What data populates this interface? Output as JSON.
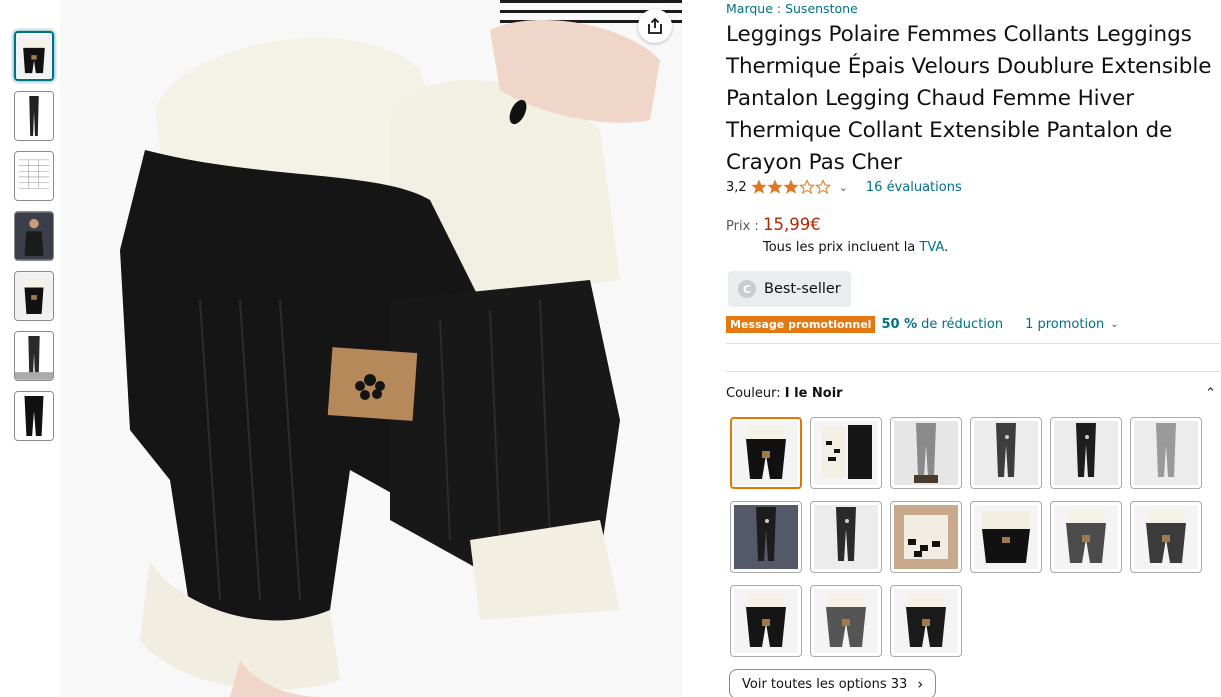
{
  "brand": "Marque : Susenstone",
  "title": "Leggings Polaire Femmes Collants Leggings Thermique Épais Velours Doublure Extensible Pantalon Legging Chaud Femme Hiver Thermique Collant Extensible Pantalon de Crayon Pas Cher",
  "rating": {
    "value": "3,2",
    "stars": 3.2,
    "reviews": "16 évaluations"
  },
  "price": {
    "label": "Prix :",
    "value": "15,99€",
    "tva_prefix": "Tous les prix incluent la ",
    "tva_link": "TVA",
    "tva_suffix": "."
  },
  "bestseller": "Best-seller",
  "promo": {
    "badge": "Message promotionnel",
    "percent": "50 %",
    "text": "de réduction",
    "link": "1 promotion"
  },
  "color": {
    "label": "Couleur: ",
    "value": "I le Noir"
  },
  "see_all": "Voir toutes les options 33",
  "colors": {
    "accent_link": "#007185",
    "price": "#b12704",
    "star": "#de7921",
    "promo_badge": "#e47911",
    "selected_border": "#e77600"
  },
  "icons": [
    "share-icon",
    "star-icon",
    "chevron-down-icon",
    "chevron-up-icon",
    "chevron-right-icon",
    "bestseller-icon"
  ]
}
